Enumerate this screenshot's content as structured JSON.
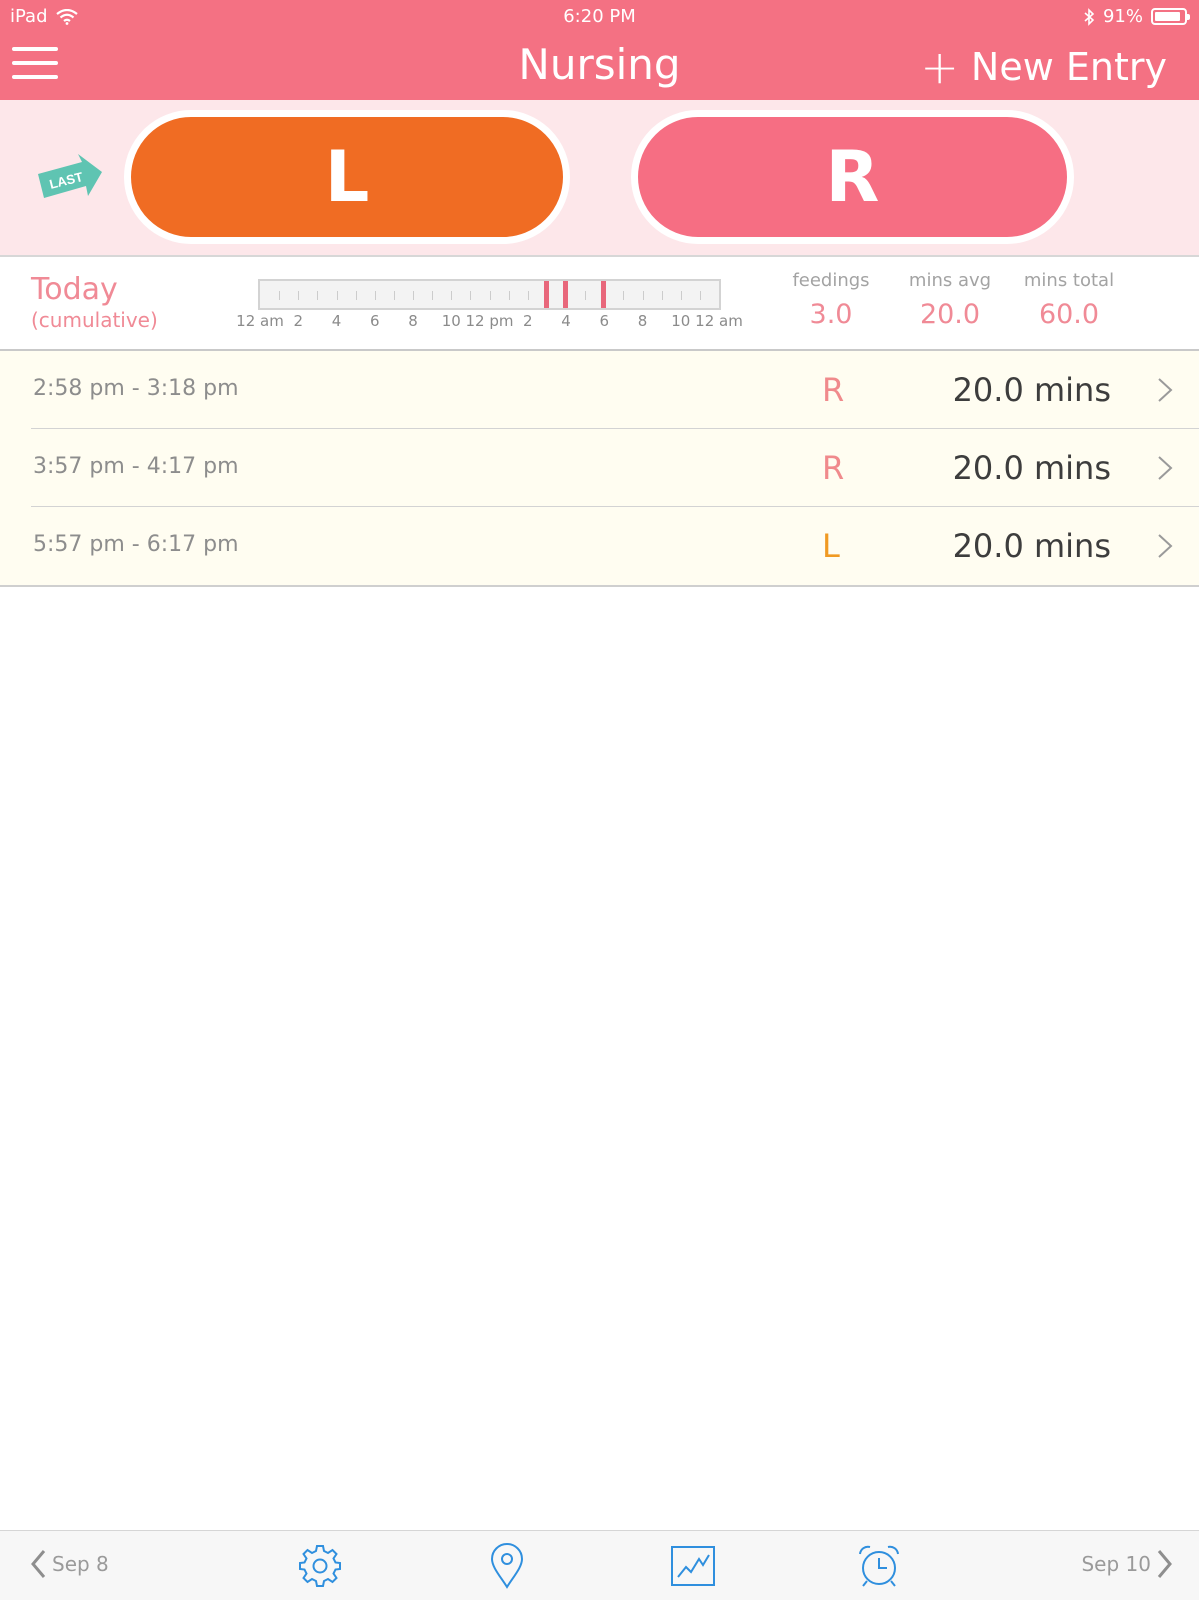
{
  "status_bar": {
    "device": "iPad",
    "time": "6:20 PM",
    "battery": "91%",
    "battery_level": 0.91
  },
  "header": {
    "title": "Nursing",
    "new_entry_label": "New Entry",
    "menu_icon": "hamburger-menu-icon",
    "accent_color": "#f47183"
  },
  "sides": {
    "last_label": "LAST",
    "left_label": "L",
    "right_label": "R",
    "left_color": "#f06c23",
    "right_color": "#f66e83"
  },
  "today": {
    "title": "Today",
    "subtitle": "(cumulative)",
    "timeline_labels": [
      "12 am",
      "2",
      "4",
      "6",
      "8",
      "10",
      "12 pm",
      "2",
      "4",
      "6",
      "8",
      "10",
      "12 am"
    ],
    "timeline_hours": [
      0,
      2,
      4,
      6,
      8,
      10,
      12,
      14,
      16,
      18,
      20,
      22,
      24
    ],
    "feeding_start_hours": [
      14.97,
      15.95,
      17.95
    ],
    "stats": {
      "feedings_label": "feedings",
      "feedings_value": "3.0",
      "avg_label": "mins avg",
      "avg_value": "20.0",
      "total_label": "mins total",
      "total_value": "60.0"
    }
  },
  "entries": [
    {
      "time": "2:58 pm - 3:18 pm",
      "side": "R",
      "duration": "20.0 mins"
    },
    {
      "time": "3:57 pm - 4:17 pm",
      "side": "R",
      "duration": "20.0 mins"
    },
    {
      "time": "5:57 pm - 6:17 pm",
      "side": "L",
      "duration": "20.0 mins"
    }
  ],
  "footer": {
    "prev_label": "Sep 8",
    "next_label": "Sep 10",
    "icons": [
      "gear-icon",
      "location-pin-icon",
      "chart-icon",
      "alarm-clock-icon"
    ],
    "icon_color": "#2f8fde"
  }
}
